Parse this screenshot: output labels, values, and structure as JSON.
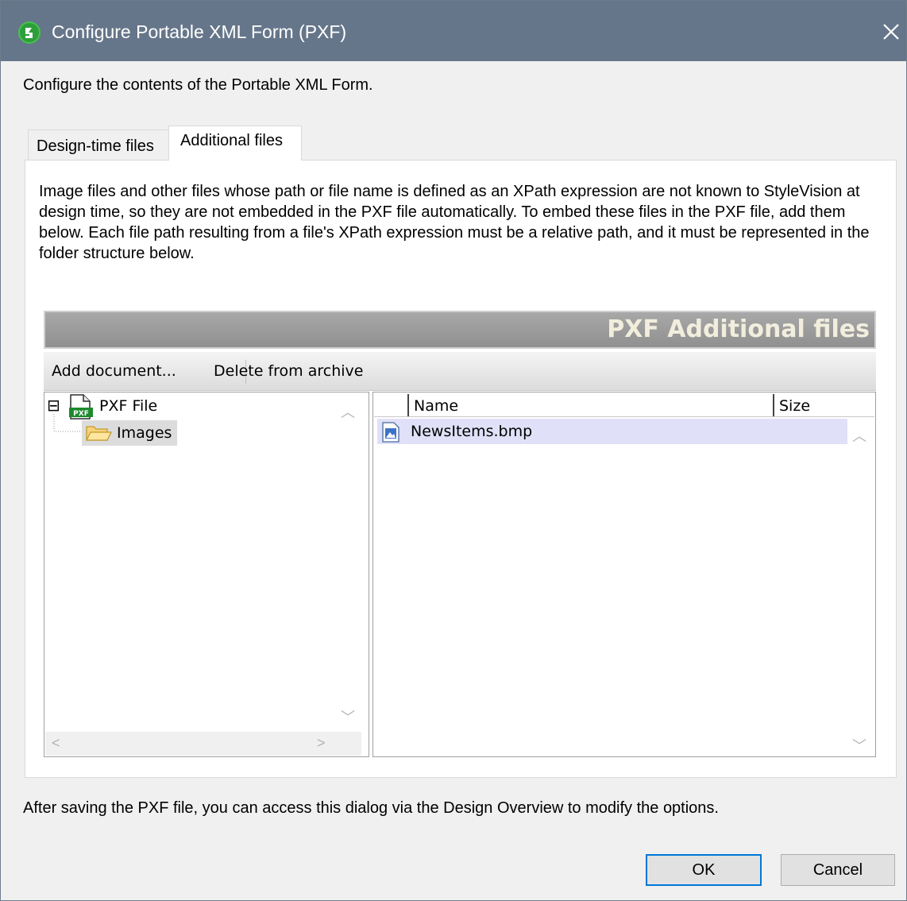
{
  "window": {
    "title": "Configure Portable XML Form (PXF)",
    "close_glyph": "✕"
  },
  "intro_text": "Configure the contents of the Portable XML Form.",
  "tabs": [
    {
      "label": "Design-time files",
      "active": false
    },
    {
      "label": "Additional files",
      "active": true
    }
  ],
  "description": "Image files and other files whose path or file name is defined as an XPath expression are not known to StyleVision at design time, so they are not embedded in the PXF file automatically. To embed these files in the PXF file, add them below. Each file path resulting from a file's XPath expression must be a relative path, and it must be represented in the folder structure below.",
  "panel": {
    "banner_title": "PXF Additional files",
    "toolbar": {
      "add_label": "Add document...",
      "delete_label": "Delete from archive"
    },
    "tree": {
      "root_label": "PXF File",
      "root_icon": "pxf-file-icon",
      "expander": "⊟",
      "children": [
        {
          "label": "Images",
          "icon": "folder-icon",
          "selected": true
        }
      ]
    },
    "list": {
      "columns": [
        "Name",
        "Size"
      ],
      "rows": [
        {
          "name": "NewsItems.bmp",
          "icon": "image-file-icon",
          "size": ""
        }
      ]
    }
  },
  "footer_text": "After saving the PXF file, you can access this dialog via the Design Overview to modify the options.",
  "buttons": {
    "ok": "OK",
    "cancel": "Cancel"
  },
  "colors": {
    "titlebar": "#66768a",
    "accent": "#0078d7",
    "banner_text": "#f2eedd",
    "selected_row": "#e0e0f8"
  }
}
